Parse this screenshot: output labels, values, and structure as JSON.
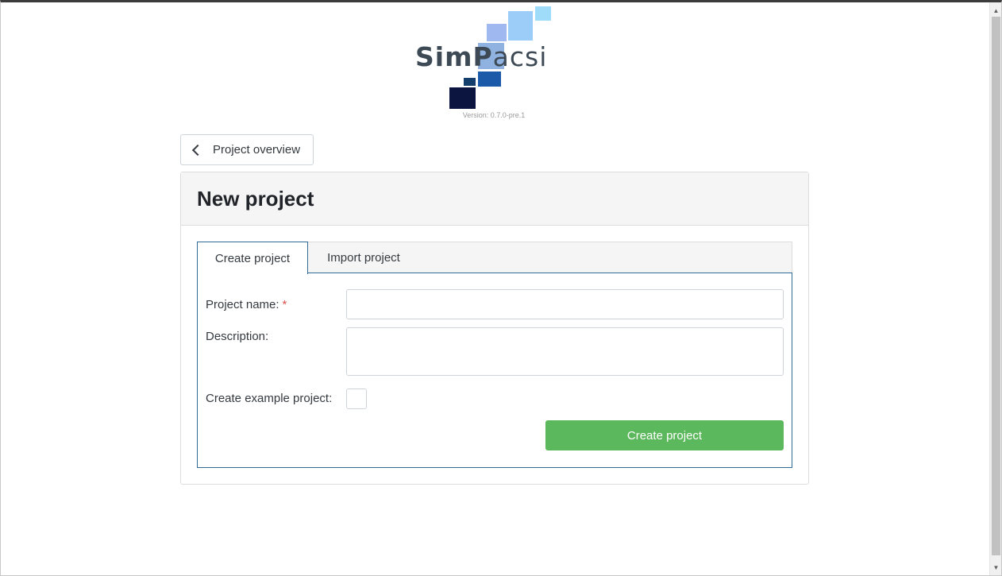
{
  "logo": {
    "word_bold": "Sim",
    "word_p": "P",
    "word_light": "acsi",
    "version": "Version: 0.7.0-pre.1"
  },
  "nav": {
    "back_label": "Project overview"
  },
  "card": {
    "title": "New project",
    "tabs": [
      {
        "label": "Create project",
        "active": true
      },
      {
        "label": "Import project",
        "active": false
      }
    ],
    "form": {
      "name_label": "Project name:",
      "required_marker": "*",
      "name_value": "",
      "description_label": "Description:",
      "description_value": "",
      "example_label": "Create example project:",
      "example_checked": false,
      "submit_label": "Create project"
    }
  },
  "colors": {
    "accent_border": "#2f6b96",
    "success": "#5cb85c",
    "required": "#d9534f"
  }
}
